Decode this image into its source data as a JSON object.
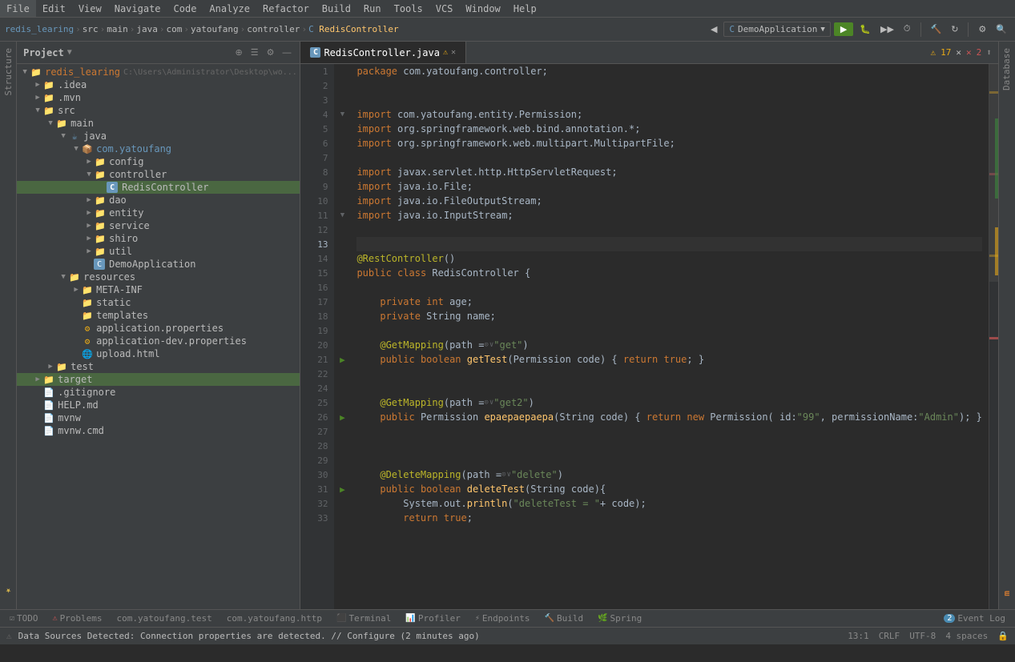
{
  "menubar": {
    "items": [
      "File",
      "Edit",
      "View",
      "Navigate",
      "Code",
      "Analyze",
      "Refactor",
      "Build",
      "Run",
      "Tools",
      "VCS",
      "Window",
      "Help"
    ]
  },
  "breadcrumb": {
    "parts": [
      "redis_learing",
      "src",
      "main",
      "java",
      "com",
      "yatoufang",
      "controller",
      "RedisController"
    ]
  },
  "run_config": {
    "label": "DemoApplication"
  },
  "project_panel": {
    "title": "Project",
    "root": "redis_learing",
    "root_path": "C:\\Users\\Administrator\\Desktop\\wo..."
  },
  "editor": {
    "tab_name": "RedisController.java",
    "warning_count": "17",
    "error_count": "2"
  },
  "code_lines": [
    {
      "num": 1,
      "text": "package com.yatoufang.controller;",
      "fold": false
    },
    {
      "num": 2,
      "text": "",
      "fold": false
    },
    {
      "num": 3,
      "text": "",
      "fold": false
    },
    {
      "num": 4,
      "text": "import com.yatoufang.entity.Permission;",
      "fold": true
    },
    {
      "num": 5,
      "text": "import org.springframework.web.bind.annotation.*;",
      "fold": false
    },
    {
      "num": 6,
      "text": "import org.springframework.web.multipart.MultipartFile;",
      "fold": false
    },
    {
      "num": 7,
      "text": "",
      "fold": false
    },
    {
      "num": 8,
      "text": "import javax.servlet.http.HttpServletRequest;",
      "fold": false
    },
    {
      "num": 9,
      "text": "import java.io.File;",
      "fold": false
    },
    {
      "num": 10,
      "text": "import java.io.FileOutputStream;",
      "fold": false
    },
    {
      "num": 11,
      "text": "import java.io.InputStream;",
      "fold": true
    },
    {
      "num": 12,
      "text": "",
      "fold": false
    },
    {
      "num": 13,
      "text": "",
      "fold": false,
      "highlighted": true
    },
    {
      "num": 14,
      "text": "@RestController()",
      "fold": false
    },
    {
      "num": 15,
      "text": "public class RedisController {",
      "fold": false
    },
    {
      "num": 16,
      "text": "",
      "fold": false
    },
    {
      "num": 17,
      "text": "    private int age;",
      "fold": false
    },
    {
      "num": 18,
      "text": "    private String name;",
      "fold": false
    },
    {
      "num": 19,
      "text": "",
      "fold": false
    },
    {
      "num": 20,
      "text": "    @GetMapping(path = \"get\")",
      "fold": false
    },
    {
      "num": 21,
      "text": "    public boolean getTest(Permission code) { return true; }",
      "fold": false
    },
    {
      "num": 22,
      "text": "",
      "fold": false
    },
    {
      "num": 24,
      "text": "",
      "fold": false
    },
    {
      "num": 25,
      "text": "    @GetMapping(path = \"get2\")",
      "fold": false
    },
    {
      "num": 26,
      "text": "    public Permission epaepaepaepа(String code) { return new Permission( id: \"99\", permissionName: \"Admin\"); }",
      "fold": false
    },
    {
      "num": 27,
      "text": "",
      "fold": false
    },
    {
      "num": 28,
      "text": "",
      "fold": false
    },
    {
      "num": 29,
      "text": "",
      "fold": false
    },
    {
      "num": 30,
      "text": "    @DeleteMapping(path = \"delete\")",
      "fold": false
    },
    {
      "num": 31,
      "text": "    public boolean deleteTest(String code){",
      "fold": false
    },
    {
      "num": 32,
      "text": "        System.out.println(\"deleteTest = \" + code);",
      "fold": false
    },
    {
      "num": 33,
      "text": "        return true;",
      "fold": false
    }
  ],
  "tree_items": [
    {
      "id": "root",
      "label": "redis_learing",
      "path": "C:\\Users\\Administrator\\Desktop\\wo...",
      "type": "module",
      "depth": 0,
      "expanded": true,
      "icon": "📁"
    },
    {
      "id": "idea",
      "label": ".idea",
      "type": "folder",
      "depth": 1,
      "expanded": false,
      "icon": "📁"
    },
    {
      "id": "mvn",
      "label": ".mvn",
      "type": "folder",
      "depth": 1,
      "expanded": false,
      "icon": "📁"
    },
    {
      "id": "src",
      "label": "src",
      "type": "folder",
      "depth": 1,
      "expanded": true,
      "icon": "📁"
    },
    {
      "id": "main",
      "label": "main",
      "type": "folder",
      "depth": 2,
      "expanded": true,
      "icon": "📁"
    },
    {
      "id": "java",
      "label": "java",
      "type": "folder",
      "depth": 3,
      "expanded": true,
      "icon": "📁"
    },
    {
      "id": "com.yatoufang",
      "label": "com.yatoufang",
      "type": "package",
      "depth": 4,
      "expanded": true,
      "icon": "📦"
    },
    {
      "id": "config",
      "label": "config",
      "type": "folder",
      "depth": 5,
      "expanded": false,
      "icon": "📁"
    },
    {
      "id": "controller",
      "label": "controller",
      "type": "folder",
      "depth": 5,
      "expanded": true,
      "icon": "📁"
    },
    {
      "id": "RedisController",
      "label": "RedisController",
      "type": "class",
      "depth": 6,
      "expanded": false,
      "icon": "C",
      "selected": true
    },
    {
      "id": "dao",
      "label": "dao",
      "type": "folder",
      "depth": 5,
      "expanded": false,
      "icon": "📁"
    },
    {
      "id": "entity",
      "label": "entity",
      "type": "folder",
      "depth": 5,
      "expanded": false,
      "icon": "📁"
    },
    {
      "id": "service",
      "label": "service",
      "type": "folder",
      "depth": 5,
      "expanded": false,
      "icon": "📁"
    },
    {
      "id": "shiro",
      "label": "shiro",
      "type": "folder",
      "depth": 5,
      "expanded": false,
      "icon": "📁"
    },
    {
      "id": "util",
      "label": "util",
      "type": "folder",
      "depth": 5,
      "expanded": false,
      "icon": "📁"
    },
    {
      "id": "DemoApplication",
      "label": "DemoApplication",
      "type": "class",
      "depth": 5,
      "expanded": false,
      "icon": "C"
    },
    {
      "id": "resources",
      "label": "resources",
      "type": "folder",
      "depth": 3,
      "expanded": true,
      "icon": "📁"
    },
    {
      "id": "META-INF",
      "label": "META-INF",
      "type": "folder",
      "depth": 4,
      "expanded": false,
      "icon": "📁"
    },
    {
      "id": "static",
      "label": "static",
      "type": "folder",
      "depth": 4,
      "expanded": false,
      "icon": "📁"
    },
    {
      "id": "templates",
      "label": "templates",
      "type": "folder",
      "depth": 4,
      "expanded": false,
      "icon": "📁"
    },
    {
      "id": "application.properties",
      "label": "application.properties",
      "type": "file",
      "depth": 4,
      "expanded": false,
      "icon": "⚙"
    },
    {
      "id": "application-dev.properties",
      "label": "application-dev.properties",
      "type": "file",
      "depth": 4,
      "expanded": false,
      "icon": "⚙"
    },
    {
      "id": "upload.html",
      "label": "upload.html",
      "type": "file",
      "depth": 4,
      "expanded": false,
      "icon": "🌐"
    },
    {
      "id": "test",
      "label": "test",
      "type": "folder",
      "depth": 2,
      "expanded": false,
      "icon": "📁"
    },
    {
      "id": "target",
      "label": "target",
      "type": "folder",
      "depth": 1,
      "expanded": false,
      "icon": "📁",
      "selected2": true
    },
    {
      "id": ".gitignore",
      "label": ".gitignore",
      "type": "file",
      "depth": 1,
      "expanded": false,
      "icon": "📄"
    },
    {
      "id": "HELP.md",
      "label": "HELP.md",
      "type": "file",
      "depth": 1,
      "expanded": false,
      "icon": "📄"
    },
    {
      "id": "mvnw",
      "label": "mvnw",
      "type": "file",
      "depth": 1,
      "expanded": false,
      "icon": "📄"
    },
    {
      "id": "mvnw.cmd",
      "label": "mvnw.cmd",
      "type": "file",
      "depth": 1,
      "expanded": false,
      "icon": "📄"
    }
  ],
  "bottom_tabs": [
    {
      "label": "TODO",
      "active": false,
      "icon": ""
    },
    {
      "label": "Problems",
      "active": false,
      "icon": ""
    },
    {
      "label": "com.yatoufang.test",
      "active": false,
      "icon": ""
    },
    {
      "label": "com.yatoufang.http",
      "active": false,
      "icon": ""
    },
    {
      "label": "Terminal",
      "active": false,
      "icon": ""
    },
    {
      "label": "Profiler",
      "active": false,
      "icon": ""
    },
    {
      "label": "Endpoints",
      "active": false,
      "icon": ""
    },
    {
      "label": "Build",
      "active": false,
      "icon": ""
    },
    {
      "label": "Spring",
      "active": false,
      "icon": ""
    }
  ],
  "status_bar": {
    "message": "Data Sources Detected: Connection properties are detected. // Configure (2 minutes ago)",
    "position": "13:1",
    "line_separator": "CRLF",
    "encoding": "UTF-8",
    "indent": "4 spaces"
  },
  "event_log": {
    "label": "Event Log",
    "count": "2"
  }
}
